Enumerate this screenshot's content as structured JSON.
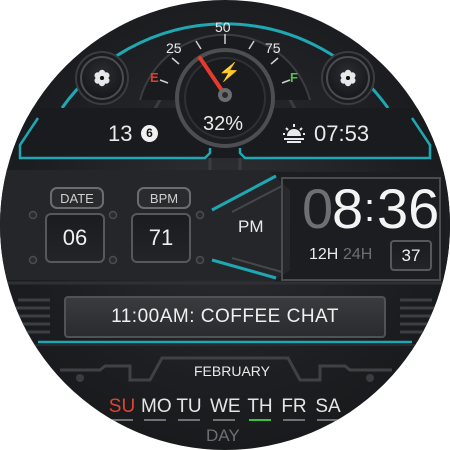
{
  "gauge": {
    "ticks": [
      "25",
      "50",
      "75"
    ],
    "empty_label": "E",
    "full_label": "F",
    "battery_percent": "32%",
    "battery_level": 0.32,
    "bolt_icon": "lightning-bolt-icon"
  },
  "notifications": {
    "count": "13",
    "badge": "6"
  },
  "sun": {
    "icon": "sunrise-icon",
    "time": "07:53"
  },
  "date_block": {
    "label": "DATE",
    "value": "06"
  },
  "bpm_block": {
    "label": "BPM",
    "value": "71"
  },
  "clock": {
    "ampm": "PM",
    "hour_dim": "0",
    "hour": "8",
    "separator": ":",
    "minutes": "36",
    "format_12": "12H",
    "format_24": "24H",
    "seconds": "37"
  },
  "event": {
    "text": "11:00AM: COFFEE CHAT"
  },
  "month": "FEBRUARY",
  "week": {
    "days": [
      "SU",
      "MO",
      "TU",
      "WE",
      "TH",
      "FR",
      "SA"
    ],
    "today": "TH",
    "footer_label": "DAY"
  },
  "colors": {
    "accent": "#1fa8b4",
    "gauge_red": "#d8261a",
    "empty_red": "#e53b2c",
    "full_green": "#4ec24a",
    "sunday_red": "#e34234",
    "today_green": "#3fbf3f",
    "dim_text": "#6d6f73"
  }
}
